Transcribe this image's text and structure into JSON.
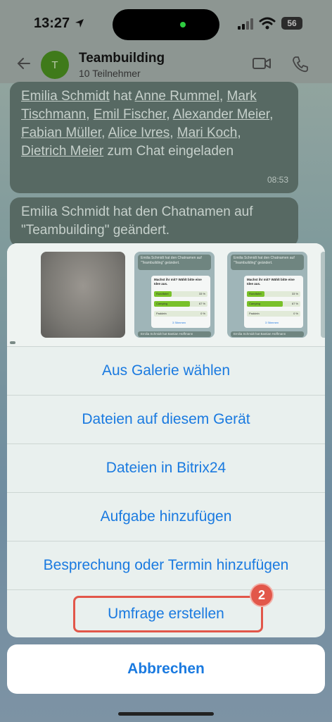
{
  "status_bar": {
    "time": "13:27",
    "battery": "56"
  },
  "header": {
    "title": "Teambuilding",
    "subtitle": "10 Teilnehmer",
    "avatar_letter": "T"
  },
  "messages": [
    {
      "segments": [
        {
          "text": "Emilia Schmidt",
          "link": true
        },
        {
          "text": " hat ",
          "link": false
        },
        {
          "text": "Anne Rummel",
          "link": true
        },
        {
          "text": ", ",
          "link": false
        },
        {
          "text": "Mark Tischmann",
          "link": true
        },
        {
          "text": ", ",
          "link": false
        },
        {
          "text": "Emil Fischer",
          "link": true
        },
        {
          "text": ", ",
          "link": false
        },
        {
          "text": "Alexander Meier",
          "link": true
        },
        {
          "text": ", ",
          "link": false
        },
        {
          "text": "Fabian Müller",
          "link": true
        },
        {
          "text": ", ",
          "link": false
        },
        {
          "text": "Alice Ivres",
          "link": true
        },
        {
          "text": ", ",
          "link": false
        },
        {
          "text": "Mari Koch",
          "link": true
        },
        {
          "text": ", ",
          "link": false
        },
        {
          "text": "Dietrich Meier",
          "link": true
        },
        {
          "text": " zum Chat eingeladen",
          "link": false
        }
      ],
      "time": "08:53"
    },
    {
      "text": "Emilia Schmidt hat den Chatnamen auf \"Teambuilding\" geändert."
    }
  ],
  "gallery": {
    "shot_header": "Emilia Schmidt hat den Chatnamen auf \"Teambuilding\" geändert.",
    "poll_question": "Machst ihr mit? Wählt bitte eine Idee aus.",
    "poll_options": [
      {
        "label": "Rundfahrt",
        "percent": "33 %",
        "fill": 0.33
      },
      {
        "label": "Camping",
        "percent": "67 %",
        "fill": 0.67
      },
      {
        "label": "Paddeln",
        "percent": "0 %",
        "fill": 0.0
      }
    ],
    "poll_vote_label": "3 Stimmen",
    "shot_footer": "Emilia Schmidt hat Bastian Hoffmann"
  },
  "menu": {
    "items": [
      "Aus Galerie wählen",
      "Dateien auf diesem Gerät",
      "Dateien in Bitrix24",
      "Aufgabe hinzufügen",
      "Besprechung oder Termin hinzufügen",
      "Umfrage erstellen"
    ],
    "cancel": "Abbrechen"
  },
  "annotation": {
    "badge": "2"
  },
  "colors": {
    "accent": "#1a7ae0",
    "highlight": "#e2574a",
    "avatar": "#3f7a1a"
  }
}
